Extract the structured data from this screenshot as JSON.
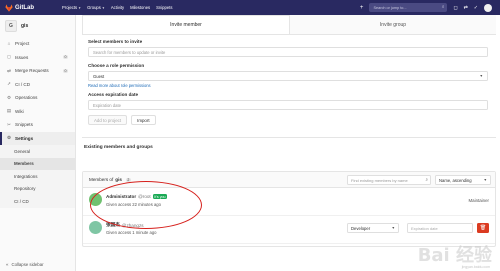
{
  "navbar": {
    "brand": "GitLab",
    "links": [
      {
        "label": "Projects",
        "caret": true
      },
      {
        "label": "Groups",
        "caret": true
      },
      {
        "label": "Activity",
        "caret": false
      },
      {
        "label": "Milestones",
        "caret": false
      },
      {
        "label": "Snippets",
        "caret": false
      }
    ],
    "search_placeholder": "Search or jump to..."
  },
  "sidebar": {
    "project_initial": "G",
    "project_name": "gis",
    "items": [
      {
        "label": "Project",
        "icon": "home-icon",
        "glyph": "⌂"
      },
      {
        "label": "Issues",
        "icon": "issues-icon",
        "glyph": "◻",
        "badge": "0"
      },
      {
        "label": "Merge Requests",
        "icon": "merge-request-icon",
        "glyph": "⇄",
        "badge": "0"
      },
      {
        "label": "CI / CD",
        "icon": "rocket-icon",
        "glyph": "➚"
      },
      {
        "label": "Operations",
        "icon": "operations-icon",
        "glyph": "⚙"
      },
      {
        "label": "Wiki",
        "icon": "book-icon",
        "glyph": "▤"
      },
      {
        "label": "Snippets",
        "icon": "scissors-icon",
        "glyph": "✂"
      },
      {
        "label": "Settings",
        "icon": "gear-icon",
        "glyph": "⚙"
      }
    ],
    "sub_items": [
      "General",
      "Members",
      "Integrations",
      "Repository",
      "CI / CD"
    ],
    "collapse_label": "Collapse sidebar"
  },
  "main": {
    "tabs": [
      "Invite member",
      "Invite group"
    ],
    "select_label": "Select members to invite",
    "search_placeholder": "Search for members to update or invite",
    "role_label": "Choose a role permission",
    "role_value": "Guest",
    "role_link": "Read more about role permissions",
    "expiry_label": "Access expiration date",
    "expiry_placeholder": "Expiration date",
    "add_button": "Add to project",
    "import_button": "Import",
    "existing_title": "Existing members and groups",
    "members_label": "Members of",
    "project_name": "gis",
    "member_count": "2",
    "filter_placeholder": "Find existing members by name",
    "sort_value": "Name, ascending",
    "members": [
      {
        "name": "Administrator",
        "handle": "@root",
        "you_badge": "It's you",
        "access": "Given access 22 minutes ago",
        "role": "Maintainer"
      },
      {
        "name": "张国杰",
        "handle": "@zhangzs",
        "access": "Given access 1 minute ago",
        "role_select": "Developer",
        "expiry_placeholder": "Expiration date"
      }
    ]
  },
  "watermark": {
    "text": "Bai 经验",
    "sub": "jingyan.baidu.com"
  },
  "colors": {
    "navbar": "#292961",
    "accent_red": "#db3b21",
    "you_badge": "#1aaa55",
    "annotation": "#d6201c"
  }
}
